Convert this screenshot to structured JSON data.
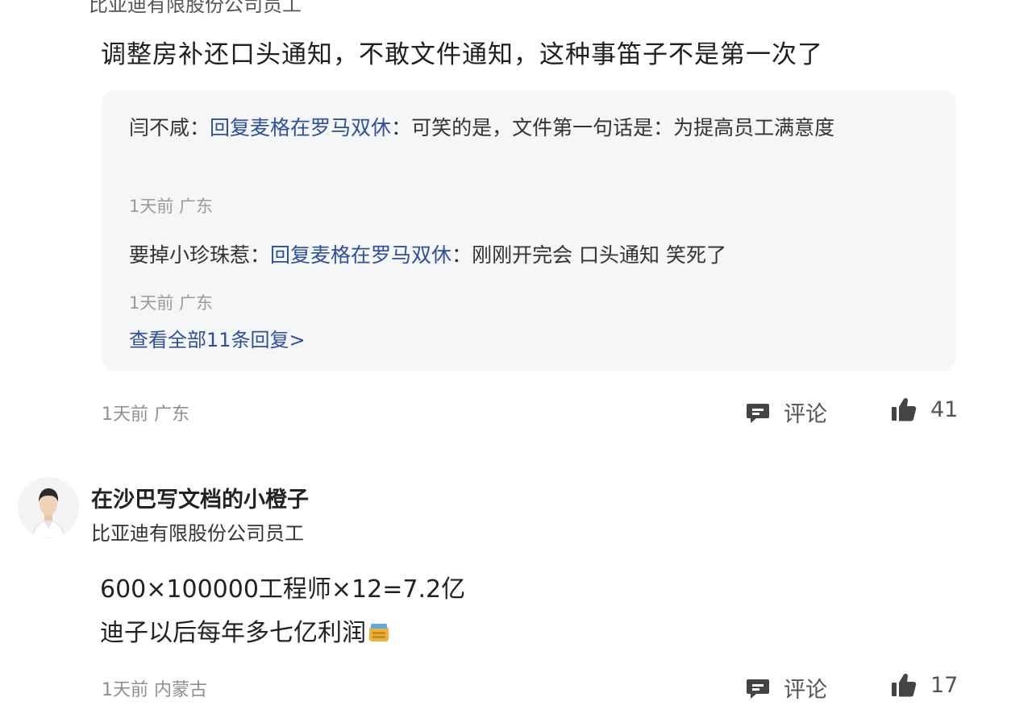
{
  "top_comment": {
    "cut_header": "比亚迪有限股份公司员工",
    "text": "调整房补还口头通知，不敢文件通知，这种事笛子不是第一次了",
    "replies": [
      {
        "user": "闫不咸",
        "separator": "：",
        "reply_prefix": "回复",
        "reply_to": "麦格在罗马双休",
        "text": "：可笑的是，文件第一句话是：为提高员工满意度",
        "time": "1天前",
        "location": "广东"
      },
      {
        "user": "要掉小珍珠惹",
        "separator": "：",
        "reply_prefix": "回复",
        "reply_to": "麦格在罗马双休",
        "text": "：刚刚开完会 口头通知 笑死了",
        "time": "1天前",
        "location": "广东"
      }
    ],
    "view_all": "查看全部11条回复>",
    "time": "1天前",
    "location": "广东",
    "comment_label": "评论",
    "likes": "41"
  },
  "second_comment": {
    "author": "在沙巴写文档的小橙子",
    "org": "比亚迪有限股份公司员工",
    "lines": [
      "600×100000工程师×12=7.2亿",
      "迪子以后每年多七亿利润"
    ],
    "emoji": "money-bag-emoji",
    "time": "1天前",
    "location": "内蒙古",
    "comment_label": "评论",
    "likes": "17"
  },
  "icons": {
    "comment": "comment-icon",
    "like": "thumbs-up-icon"
  },
  "colors": {
    "link": "#2e4f9c",
    "reply_bg": "#f5f6f8",
    "meta": "#8f8f8f"
  }
}
